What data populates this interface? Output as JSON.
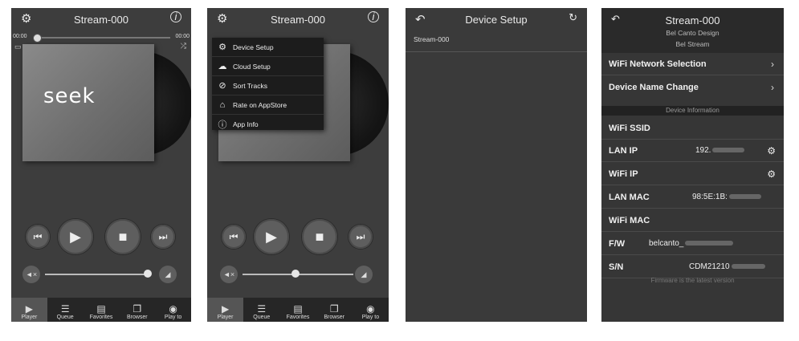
{
  "player": {
    "title": "Stream-000",
    "time_start": "00:00",
    "time_end": "00:00",
    "art_text": "seek",
    "tabs": [
      {
        "label": "Player",
        "icon": "play-icon"
      },
      {
        "label": "Queue",
        "icon": "queue-icon"
      },
      {
        "label": "Favorites",
        "icon": "favorites-icon"
      },
      {
        "label": "Browser",
        "icon": "browser-icon"
      },
      {
        "label": "Play to",
        "icon": "play-to-icon"
      }
    ]
  },
  "menu_screen": {
    "title": "Stream-000",
    "items": [
      {
        "label": "Device Setup",
        "icon": "gear-icon"
      },
      {
        "label": "Cloud Setup",
        "icon": "cloud-icon"
      },
      {
        "label": "Sort Tracks",
        "icon": "sort-icon"
      },
      {
        "label": "Rate on AppStore",
        "icon": "basket-icon"
      },
      {
        "label": "App Info",
        "icon": "info-icon"
      }
    ]
  },
  "device_setup": {
    "title": "Device Setup",
    "device": "Stream-000"
  },
  "device_detail": {
    "title": "Stream-000",
    "subtitle1": "Bel Canto Design",
    "subtitle2": "Bel Stream",
    "wifi_network": "WiFi Network Selection",
    "name_change": "Device Name Change",
    "section_label": "Device Information",
    "wifi_ssid_label": "WiFi SSID",
    "lan_ip_label": "LAN IP",
    "lan_ip_value": "192.",
    "wifi_ip_label": "WiFi IP",
    "lan_mac_label": "LAN MAC",
    "lan_mac_value": "98:5E:1B:",
    "wifi_mac_label": "WiFi MAC",
    "fw_label": "F/W",
    "fw_value": "belcanto_",
    "sn_label": "S/N",
    "sn_value": "CDM21210",
    "footer": "Firmware is the latest version"
  }
}
